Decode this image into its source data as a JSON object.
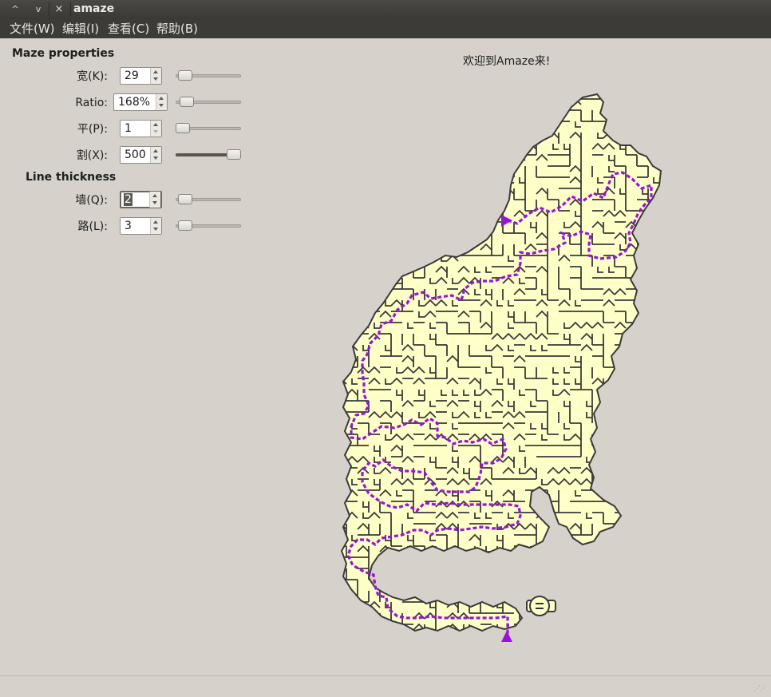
{
  "window": {
    "title": "amaze",
    "controls": {
      "up": "^",
      "down": "v",
      "close": "×"
    }
  },
  "menu": [
    "文件(W)",
    "编辑(I)",
    "查看(C)",
    "帮助(B)"
  ],
  "panel": {
    "maze_section": "Maze properties",
    "line_section": "Line thickness",
    "fields": [
      {
        "label": "宽(K):",
        "value": "29",
        "slider_fraction": 0.05
      },
      {
        "label": "Ratio:",
        "value": "168%",
        "slider_fraction": 0.08
      },
      {
        "label": "平(P):",
        "value": "1",
        "slider_fraction": 0.0
      },
      {
        "label": "割(X):",
        "value": "500",
        "slider_fraction": 1.0
      },
      {
        "label": "墙(Q):",
        "value": "2",
        "slider_fraction": 0.05
      },
      {
        "label": "路(L):",
        "value": "3",
        "slider_fraction": 0.05
      }
    ]
  },
  "greeting": "欢迎到Amaze来!",
  "maze": {
    "fill_color": "#ffffc8",
    "wall_color": "#3a3a3a",
    "path_color": "#9a14d4",
    "shape": "cat"
  },
  "status": ""
}
